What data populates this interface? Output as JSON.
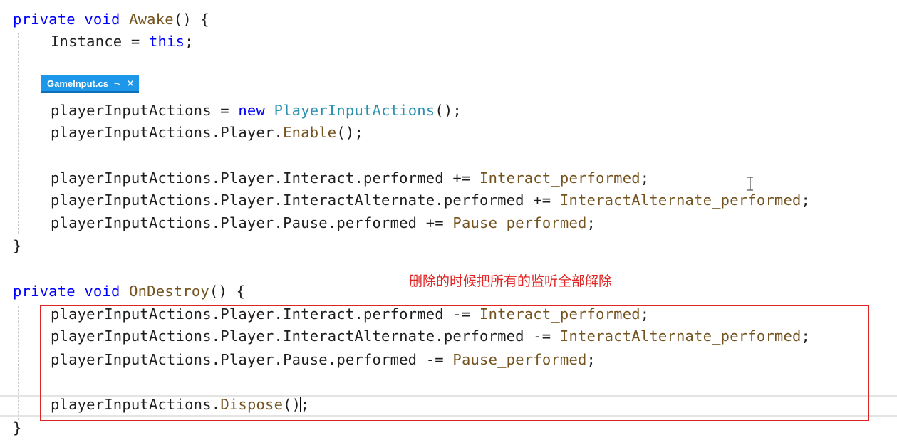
{
  "editor": {
    "tab_chip": {
      "filename": "GameInput.cs",
      "pin_icon": "pin-icon",
      "close_icon": "close-icon"
    },
    "lines": [
      [
        {
          "t": "private ",
          "c": "kw"
        },
        {
          "t": "void ",
          "c": "kw"
        },
        {
          "t": "Awake",
          "c": "mth"
        },
        {
          "t": "() {",
          "c": "plain"
        }
      ],
      [
        {
          "t": "Instance = ",
          "c": "plain"
        },
        {
          "t": "this",
          "c": "kw"
        },
        {
          "t": ";",
          "c": "plain"
        }
      ],
      [
        {
          "t": "playerInputActions = ",
          "c": "plain"
        },
        {
          "t": "new ",
          "c": "kw"
        },
        {
          "t": "PlayerInputActions",
          "c": "typ"
        },
        {
          "t": "();",
          "c": "plain"
        }
      ],
      [
        {
          "t": "playerInputActions.Player.",
          "c": "plain"
        },
        {
          "t": "Enable",
          "c": "mth"
        },
        {
          "t": "();",
          "c": "plain"
        }
      ],
      [
        {
          "t": "playerInputActions.Player.Interact.performed += ",
          "c": "plain"
        },
        {
          "t": "Interact_performed",
          "c": "mth"
        },
        {
          "t": ";",
          "c": "plain"
        }
      ],
      [
        {
          "t": "playerInputActions.Player.InteractAlternate.performed += ",
          "c": "plain"
        },
        {
          "t": "InteractAlternate_performed",
          "c": "mth"
        },
        {
          "t": ";",
          "c": "plain"
        }
      ],
      [
        {
          "t": "playerInputActions.Player.Pause.performed += ",
          "c": "plain"
        },
        {
          "t": "Pause_performed",
          "c": "mth"
        },
        {
          "t": ";",
          "c": "plain"
        }
      ],
      [
        {
          "t": "}",
          "c": "plain"
        }
      ],
      [
        {
          "t": "private ",
          "c": "kw"
        },
        {
          "t": "void ",
          "c": "kw"
        },
        {
          "t": "OnDestroy",
          "c": "mth"
        },
        {
          "t": "() {",
          "c": "plain"
        }
      ],
      [
        {
          "t": "playerInputActions.Player.Interact.performed -= ",
          "c": "plain"
        },
        {
          "t": "Interact_performed",
          "c": "mth"
        },
        {
          "t": ";",
          "c": "plain"
        }
      ],
      [
        {
          "t": "playerInputActions.Player.InteractAlternate.performed -= ",
          "c": "plain"
        },
        {
          "t": "InteractAlternate_performed",
          "c": "mth"
        },
        {
          "t": ";",
          "c": "plain"
        }
      ],
      [
        {
          "t": "playerInputActions.Player.Pause.performed -= ",
          "c": "plain"
        },
        {
          "t": "Pause_performed",
          "c": "mth"
        },
        {
          "t": ";",
          "c": "plain"
        }
      ],
      [
        {
          "t": "playerInputActions.",
          "c": "plain"
        },
        {
          "t": "Dispose",
          "c": "mth"
        },
        {
          "t": "()",
          "c": "plain"
        },
        {
          "t": ";",
          "c": "plain",
          "caret": true
        }
      ],
      [
        {
          "t": "}",
          "c": "plain"
        }
      ]
    ]
  },
  "annotation": {
    "text": "删除的时候把所有的监听全部解除",
    "color": "#e02424"
  },
  "colors": {
    "keyword": "#0000ff",
    "method": "#74531f",
    "type": "#2b91af",
    "plain": "#1e1e1e",
    "tab_chip": "#1c97ea",
    "highlight_box": "#e02424"
  }
}
